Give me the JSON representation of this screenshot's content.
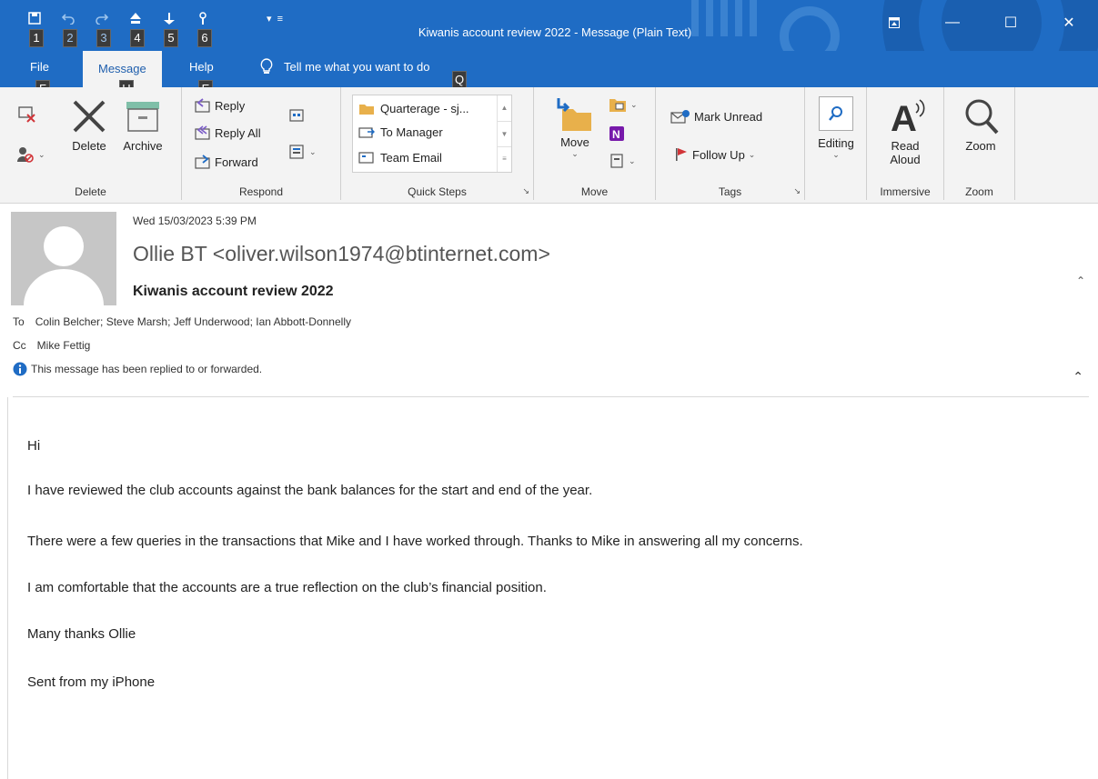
{
  "window": {
    "title": "Kiwanis account review 2022  -  Message (Plain Text)",
    "accent": "#1f6cc4"
  },
  "qat": {
    "keytips": [
      "1",
      "2",
      "3",
      "4",
      "5",
      "6"
    ],
    "icons": [
      "save-icon",
      "undo-icon",
      "redo-icon",
      "up-icon",
      "down-icon",
      "touch-mode-icon"
    ]
  },
  "tabs": [
    {
      "label": "File",
      "keytip": "F"
    },
    {
      "label": "Message",
      "keytip": "H"
    },
    {
      "label": "Help",
      "keytip": "E"
    }
  ],
  "tell_me": {
    "label": "Tell me what you want to do",
    "keytip": "Q"
  },
  "ribbon": {
    "delete_group": {
      "label": "Delete",
      "delete": "Delete",
      "archive": "Archive"
    },
    "respond_group": {
      "label": "Respond",
      "reply": "Reply",
      "reply_all": "Reply All",
      "forward": "Forward"
    },
    "quick_steps_group": {
      "label": "Quick Steps",
      "items": [
        "Quarterage - sj...",
        "To Manager",
        "Team Email"
      ]
    },
    "move_group": {
      "label": "Move",
      "move": "Move"
    },
    "tags_group": {
      "label": "Tags",
      "mark_unread": "Mark Unread",
      "follow_up": "Follow Up"
    },
    "editing_group": {
      "editing": "Editing"
    },
    "immersive_group": {
      "label": "Immersive",
      "read_aloud_1": "Read",
      "read_aloud_2": "Aloud"
    },
    "zoom_group": {
      "label": "Zoom",
      "zoom": "Zoom"
    }
  },
  "message": {
    "date": "Wed 15/03/2023 5:39 PM",
    "from": "Ollie BT <oliver.wilson1974@btinternet.com>",
    "subject": "Kiwanis account review 2022",
    "to_label": "To",
    "to": "Colin Belcher; Steve Marsh; Jeff Underwood; Ian Abbott-Donnelly",
    "cc_label": "Cc",
    "cc": "Mike Fettig",
    "info": "This message has been replied to or forwarded.",
    "body": [
      "Hi",
      "I have reviewed the club accounts against the bank balances for the start and end of the year.",
      "There were a few queries in the transactions that Mike and I have worked through. Thanks to Mike in answering all my concerns.",
      "I am comfortable that the accounts are a true reflection on the club’s financial position.",
      "Many thanks Ollie",
      "Sent from my iPhone"
    ]
  }
}
